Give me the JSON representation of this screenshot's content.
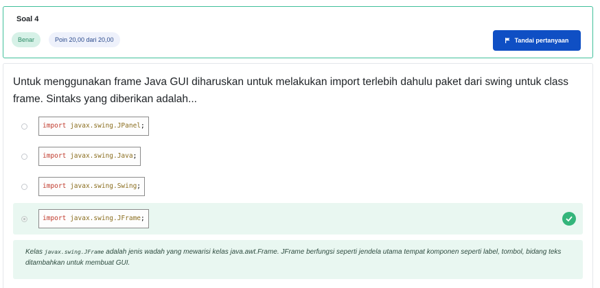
{
  "info": {
    "question_label": "Soal 4",
    "status_badge": "Benar",
    "points_badge": "Poin 20,00 dari 20,00",
    "flag_button": "Tandai pertanyaan"
  },
  "question": {
    "text": "Untuk menggunakan frame Java GUI diharuskan untuk melakukan import terlebih dahulu paket dari swing untuk class frame. Sintaks yang diberikan adalah...",
    "options": [
      {
        "keyword": "import",
        "package": "javax.swing.JPanel",
        "end": ";",
        "selected": false
      },
      {
        "keyword": "import",
        "package": "javax.swing.Java",
        "end": ";",
        "selected": false
      },
      {
        "keyword": "import",
        "package": "javax.swing.Swing",
        "end": ";",
        "selected": false
      },
      {
        "keyword": "import",
        "package": "javax.swing.JFrame",
        "end": ";",
        "selected": true,
        "correct": true
      }
    ]
  },
  "feedback": {
    "prefix": "Kelas ",
    "code": "javax.swing.JFrame",
    "suffix": " adalah jenis wadah yang mewarisi kelas java.awt.Frame. JFrame berfungsi seperti jendela utama tempat komponen seperti label, tombol, bidang teks ditambahkan untuk membuat GUI."
  },
  "colors": {
    "accent_blue": "#0f4fc4",
    "correct_green": "#34b57b",
    "correct_bg": "#e9f7f1",
    "code_keyword": "#c0392b"
  },
  "icons": [
    "flag-icon",
    "checkmark-icon",
    "radio-icon"
  ]
}
